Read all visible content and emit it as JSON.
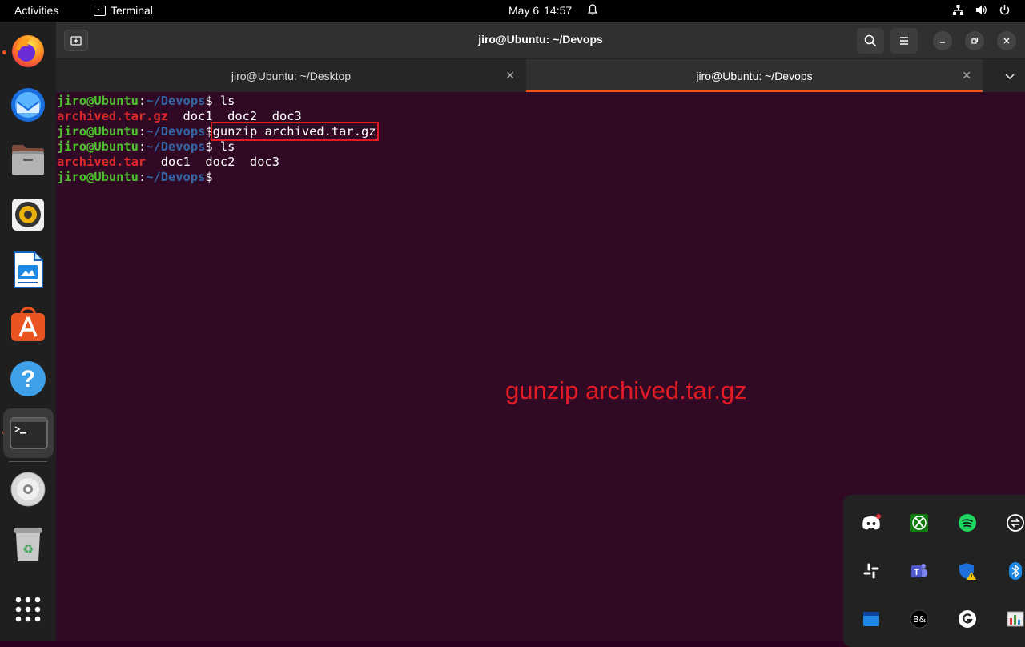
{
  "topbar": {
    "activities": "Activities",
    "app_name": "Terminal",
    "date": "May 6",
    "time": "14:57"
  },
  "dock": {
    "items": [
      {
        "name": "firefox-icon"
      },
      {
        "name": "thunderbird-icon"
      },
      {
        "name": "files-icon"
      },
      {
        "name": "rhythmbox-icon"
      },
      {
        "name": "libreoffice-writer-icon"
      },
      {
        "name": "ubuntu-software-icon"
      },
      {
        "name": "help-icon"
      },
      {
        "name": "terminal-icon"
      },
      {
        "name": "dvd-drive-icon"
      },
      {
        "name": "trash-icon"
      },
      {
        "name": "show-apps-icon"
      }
    ]
  },
  "window": {
    "title": "jiro@Ubuntu: ~/Devops"
  },
  "tabs": [
    {
      "label": "jiro@Ubuntu: ~/Desktop",
      "active": false
    },
    {
      "label": "jiro@Ubuntu: ~/Devops",
      "active": true
    }
  ],
  "terminal": {
    "user_host": "jiro@Ubuntu",
    "colon": ":",
    "path": "~/Devops",
    "dollar": "$ ",
    "cmd1": "ls",
    "out1_file": "archived.tar.gz",
    "out1_rest": "  doc1  doc2  doc3",
    "cmd2": "gunzip archived.tar.gz",
    "cmd3": "ls",
    "out2_file": "archived.tar",
    "out2_rest": "  doc1  doc2  doc3"
  },
  "caption": "gunzip archived.tar.gz",
  "colors": {
    "accent": "#e95420",
    "terminal_bg": "#300a24",
    "prompt_user": "#4ec030",
    "prompt_path": "#3465a4",
    "archive_file": "#e02a2a",
    "highlight_box": "#e01b24"
  }
}
